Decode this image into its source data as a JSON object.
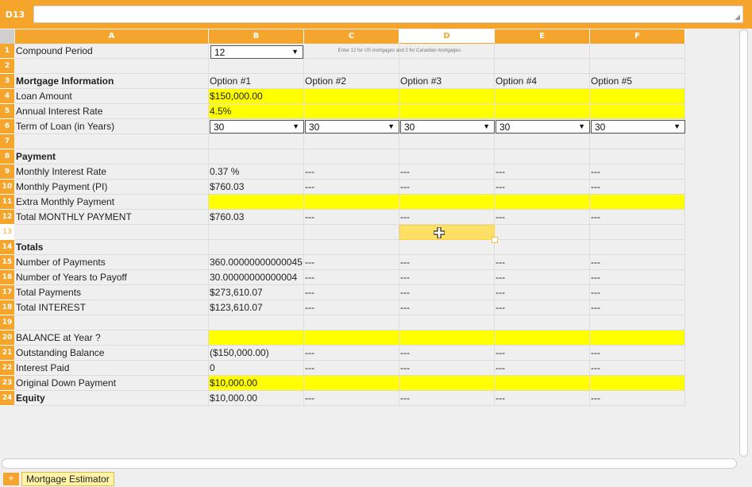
{
  "formula_bar": {
    "cell_ref": "D13",
    "formula": ""
  },
  "columns": [
    "A",
    "B",
    "C",
    "D",
    "E",
    "F"
  ],
  "selected_column": "D",
  "selected_row": "13",
  "rows": [
    {
      "num": "1",
      "a": "Compound Period",
      "b": "",
      "c": "",
      "d": "",
      "e": "",
      "f": ""
    },
    {
      "num": "2",
      "a": "",
      "b": "",
      "c": "",
      "d": "",
      "e": "",
      "f": ""
    },
    {
      "num": "3",
      "a": "Mortgage Information",
      "b": "Option #1",
      "c": "Option #2",
      "d": "Option #3",
      "e": "Option #4",
      "f": "Option #5"
    },
    {
      "num": "4",
      "a": "Loan Amount",
      "b": "$150,000.00",
      "c": "",
      "d": "",
      "e": "",
      "f": ""
    },
    {
      "num": "5",
      "a": "Annual Interest Rate",
      "b": "4.5%",
      "c": "",
      "d": "",
      "e": "",
      "f": ""
    },
    {
      "num": "6",
      "a": "Term of Loan (in Years)",
      "b": "",
      "c": "",
      "d": "",
      "e": "",
      "f": ""
    },
    {
      "num": "7",
      "a": "",
      "b": "",
      "c": "",
      "d": "",
      "e": "",
      "f": ""
    },
    {
      "num": "8",
      "a": "Payment",
      "b": "",
      "c": "",
      "d": "",
      "e": "",
      "f": ""
    },
    {
      "num": "9",
      "a": "Monthly Interest Rate",
      "b": "0.37 %",
      "c": "---",
      "d": "---",
      "e": "---",
      "f": "---"
    },
    {
      "num": "10",
      "a": "Monthly Payment (PI)",
      "b": "$760.03",
      "c": "---",
      "d": "---",
      "e": "---",
      "f": "---"
    },
    {
      "num": "11",
      "a": "Extra Monthly Payment",
      "b": "",
      "c": "",
      "d": "",
      "e": "",
      "f": ""
    },
    {
      "num": "12",
      "a": "Total MONTHLY PAYMENT",
      "b": "$760.03",
      "c": "---",
      "d": "---",
      "e": "---",
      "f": "---"
    },
    {
      "num": "13",
      "a": "",
      "b": "",
      "c": "",
      "d": "",
      "e": "",
      "f": ""
    },
    {
      "num": "14",
      "a": "Totals",
      "b": "",
      "c": "",
      "d": "",
      "e": "",
      "f": ""
    },
    {
      "num": "15",
      "a": "Number of Payments",
      "b": "360.00000000000045",
      "c": "---",
      "d": "---",
      "e": "---",
      "f": "---"
    },
    {
      "num": "16",
      "a": "Number of Years to Payoff",
      "b": "30.00000000000004",
      "c": "---",
      "d": "---",
      "e": "---",
      "f": "---"
    },
    {
      "num": "17",
      "a": "Total Payments",
      "b": "$273,610.07",
      "c": "---",
      "d": "---",
      "e": "---",
      "f": "---"
    },
    {
      "num": "18",
      "a": "Total INTEREST",
      "b": "$123,610.07",
      "c": "---",
      "d": "---",
      "e": "---",
      "f": "---"
    },
    {
      "num": "19",
      "a": "",
      "b": "",
      "c": "",
      "d": "",
      "e": "",
      "f": ""
    },
    {
      "num": "20",
      "a": "BALANCE at Year ?",
      "b": "",
      "c": "",
      "d": "",
      "e": "",
      "f": ""
    },
    {
      "num": "21",
      "a": "Outstanding Balance",
      "b": "($150,000.00)",
      "c": "---",
      "d": "---",
      "e": "---",
      "f": "---"
    },
    {
      "num": "22",
      "a": "Interest Paid",
      "b": "0",
      "c": "---",
      "d": "---",
      "e": "---",
      "f": "---"
    },
    {
      "num": "23",
      "a": "Original Down Payment",
      "b": "$10,000.00",
      "c": "",
      "d": "",
      "e": "",
      "f": ""
    },
    {
      "num": "24",
      "a": "Equity",
      "b": "$10,000.00",
      "c": "---",
      "d": "---",
      "e": "---",
      "f": "---"
    }
  ],
  "compound_select": {
    "value": "12",
    "arrow": "▼"
  },
  "compound_note": "Enter 12 for US mortgages and 2 for Canadian mortgages.",
  "term_selects": [
    {
      "value": "30",
      "arrow": "▼"
    },
    {
      "value": "30",
      "arrow": "▼"
    },
    {
      "value": "30",
      "arrow": "▼"
    },
    {
      "value": "30",
      "arrow": "▼"
    },
    {
      "value": "30",
      "arrow": "▼"
    }
  ],
  "sheet_tabs": {
    "add_label": "+",
    "active_tab": "Mortgage Estimator"
  },
  "icons": {
    "resize_grip": "resize-grip-icon",
    "move_cursor": "move-cursor-icon"
  },
  "colors": {
    "accent": "#f5a52b",
    "highlight": "#ffff00",
    "selection": "#ffe066"
  }
}
